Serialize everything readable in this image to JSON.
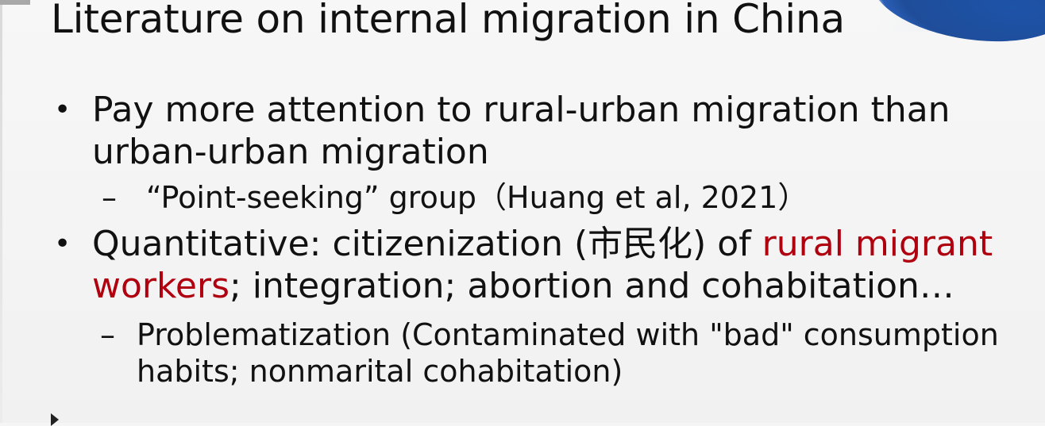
{
  "slide": {
    "title": "Literature on internal migration in China",
    "bullets": [
      {
        "marker": "•",
        "text": "Pay more attention to rural-urban migration than urban-urban migration",
        "sub": {
          "marker": "–",
          "text": "“Point-seeking” group（Huang et al, 2021）"
        }
      },
      {
        "marker": "•",
        "text_before": "Quantitative: citizenization (市民化) of ",
        "text_highlight": "rural migrant workers",
        "text_after": "; integration; abortion and cohabitation…",
        "sub": {
          "marker": "–",
          "text": "Problematization (Contaminated with \"bad\" consumption habits; nonmarital cohabitation)"
        }
      }
    ],
    "colors": {
      "background": "#f5f5f5",
      "text": "#111111",
      "highlight": "#b00010",
      "accent": "#1f4d9a"
    }
  }
}
